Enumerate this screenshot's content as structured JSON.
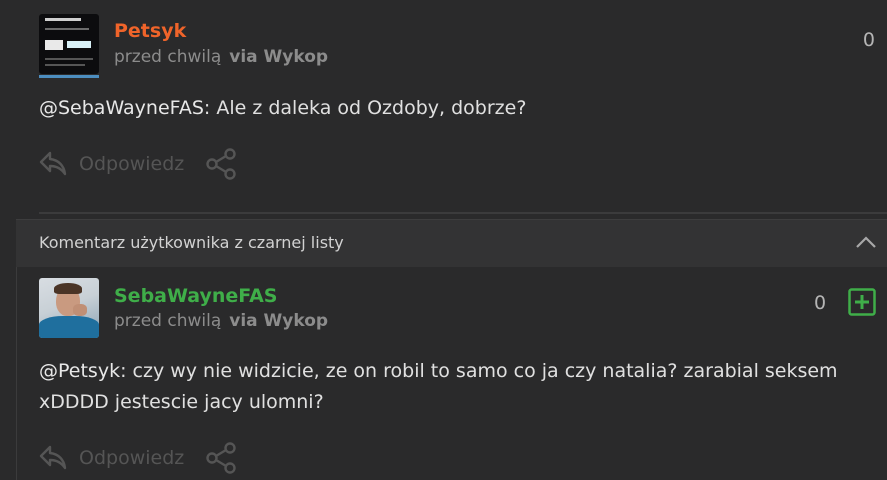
{
  "comment1": {
    "author": "Petsyk",
    "time": "przed chwilą",
    "via": "via Wykop",
    "votes": "0",
    "mention": "@SebaWayneFAS",
    "body": ": Ale z daleka od Ozdoby, dobrze?",
    "reply_label": "Odpowiedz"
  },
  "blacklist": {
    "header": "Komentarz użytkownika z czarnej listy"
  },
  "comment2": {
    "author": "SebaWayneFAS",
    "time": "przed chwilą",
    "via": "via Wykop",
    "votes": "0",
    "mention": "@Petsyk",
    "body_line1": ": czy wy nie widzicie, ze on robil to samo co ja czy natalia? zarabial seksem",
    "body_line2": "xDDDD jestescie jacy ulomni?",
    "reply_label": "Odpowiedz"
  },
  "colors": {
    "author1": "#f0642a",
    "author2": "#3fae49",
    "plus": "#3fae49",
    "background": "#2a2a2b"
  },
  "icons": [
    "reply-icon",
    "share-icon",
    "chevron-up-icon",
    "plus-icon"
  ]
}
